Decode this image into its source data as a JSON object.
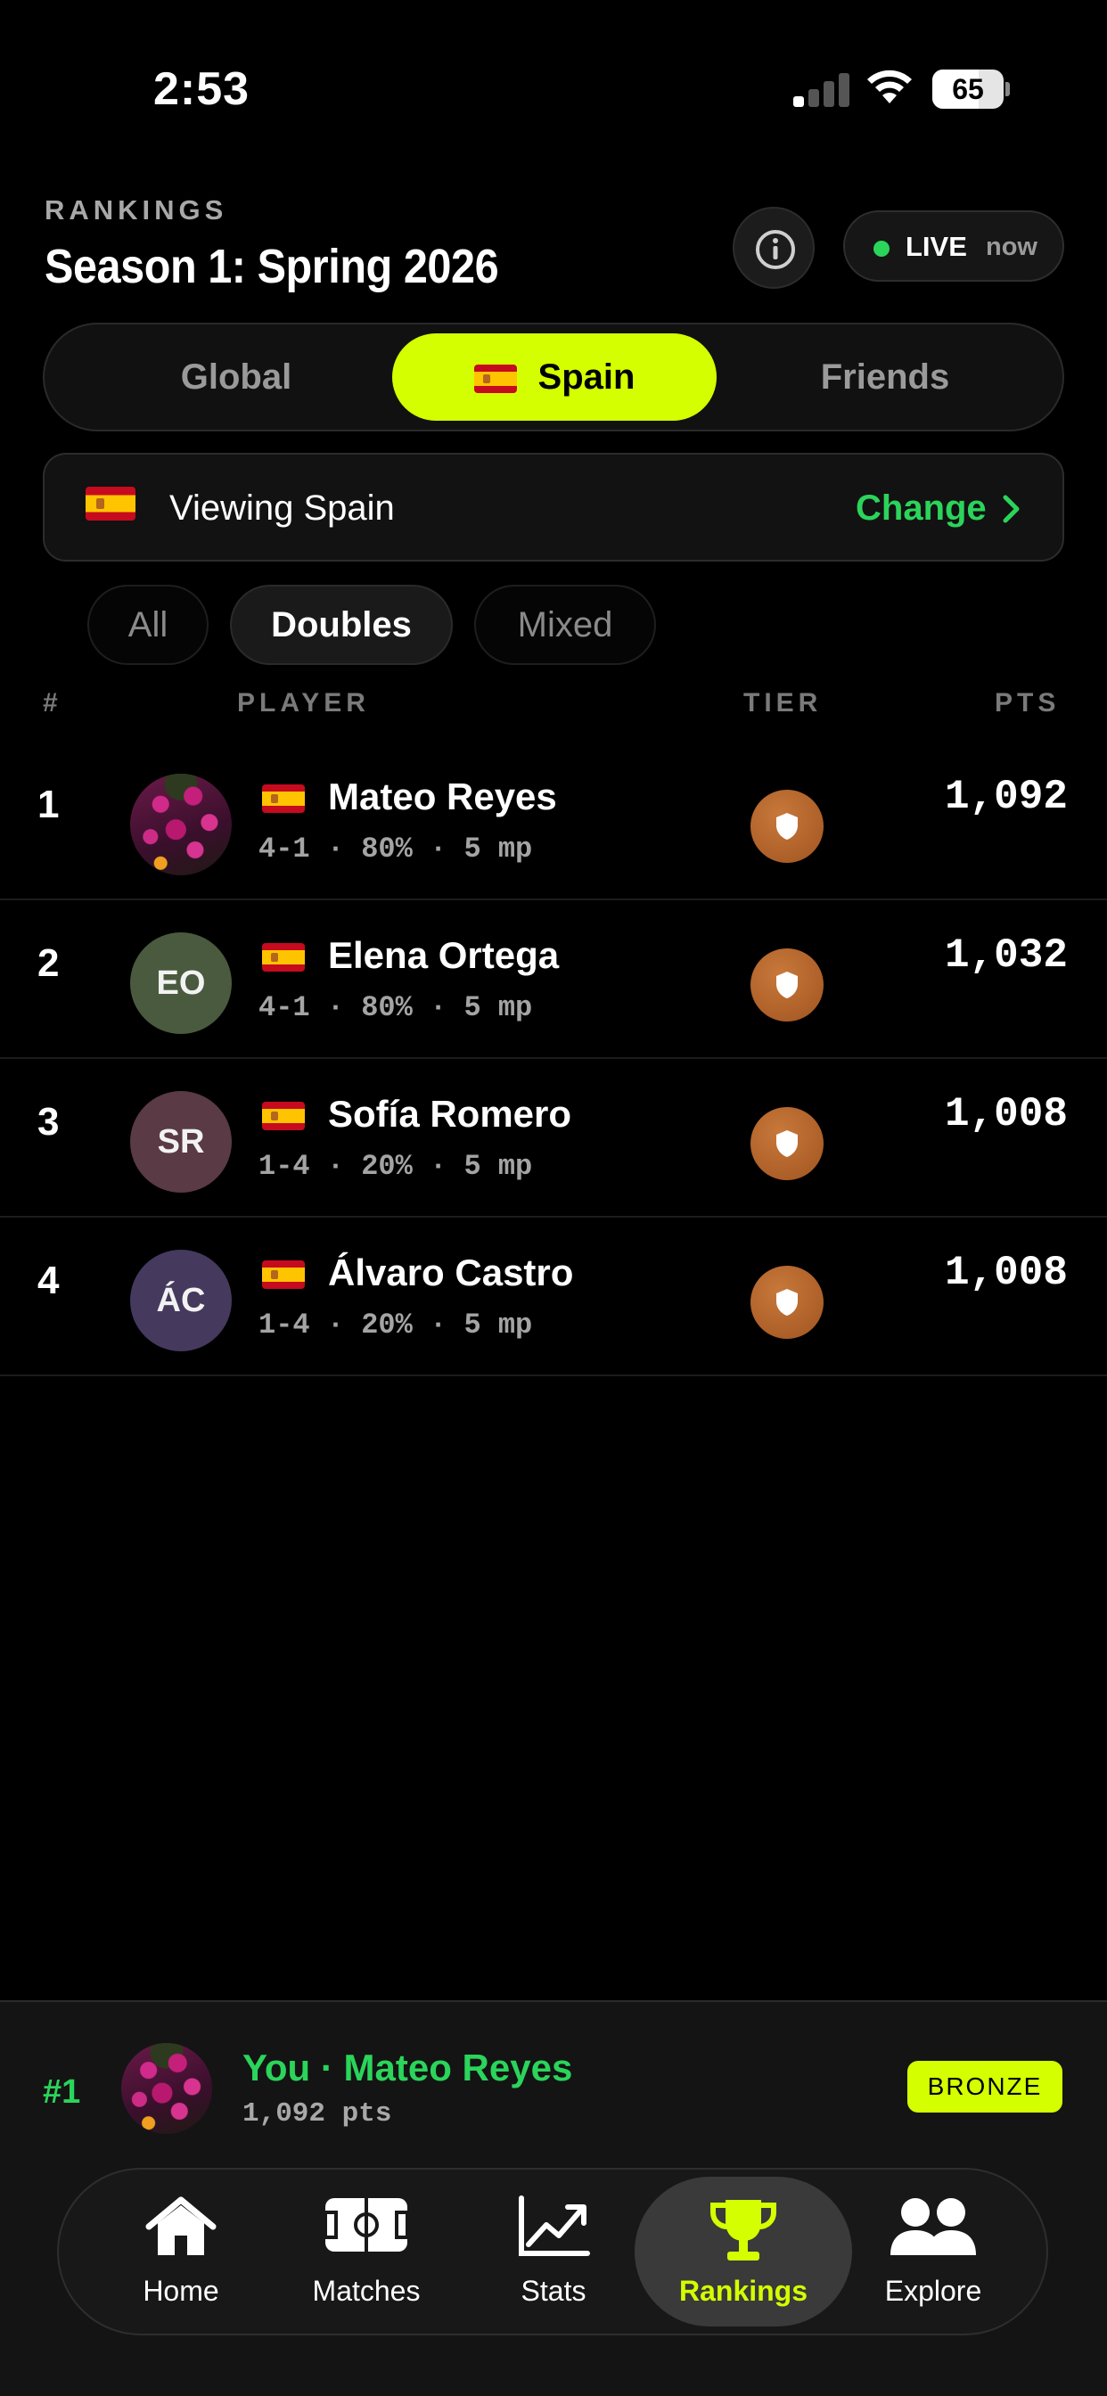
{
  "status_bar": {
    "time": "2:53",
    "battery": "65"
  },
  "header": {
    "eyebrow": "RANKINGS",
    "title": "Season 1: Spring 2026",
    "live_label": "LIVE",
    "live_when": "now"
  },
  "scope_tabs": [
    {
      "label": "Global",
      "selected": false
    },
    {
      "label": "Spain",
      "selected": true,
      "flag": "es-flag-icon"
    },
    {
      "label": "Friends",
      "selected": false
    }
  ],
  "viewing": {
    "text": "Viewing Spain",
    "action": "Change"
  },
  "filters": [
    {
      "label": "All",
      "selected": false
    },
    {
      "label": "Doubles",
      "selected": true
    },
    {
      "label": "Mixed",
      "selected": false
    }
  ],
  "columns": {
    "rank": "#",
    "player": "PLAYER",
    "tier": "TIER",
    "points": "PTS"
  },
  "rows": [
    {
      "rank": "1",
      "name": "Mateo Reyes",
      "initials": "",
      "avatar": "photo",
      "meta": "4-1 · 80% · 5 mp",
      "points": "1,092",
      "tier": "bronze"
    },
    {
      "rank": "2",
      "name": "Elena Ortega",
      "initials": "EO",
      "avatar_color": "#4a5a3e",
      "meta": "4-1 · 80% · 5 mp",
      "points": "1,032",
      "tier": "bronze"
    },
    {
      "rank": "3",
      "name": "Sofía Romero",
      "initials": "SR",
      "avatar_color": "#5a3a44",
      "meta": "1-4 · 20% · 5 mp",
      "points": "1,008",
      "tier": "bronze"
    },
    {
      "rank": "4",
      "name": "Álvaro Castro",
      "initials": "ÁC",
      "avatar_color": "#45395e",
      "meta": "1-4 · 20% · 5 mp",
      "points": "1,008",
      "tier": "bronze"
    }
  ],
  "you": {
    "rank": "#1",
    "name": "You · Mateo Reyes",
    "points": "1,092 pts",
    "tier": "BRONZE"
  },
  "tabbar": [
    {
      "label": "Home",
      "icon": "home-icon",
      "selected": false
    },
    {
      "label": "Matches",
      "icon": "court-icon",
      "selected": false
    },
    {
      "label": "Stats",
      "icon": "chart-icon",
      "selected": false
    },
    {
      "label": "Rankings",
      "icon": "trophy-icon",
      "selected": true
    },
    {
      "label": "Explore",
      "icon": "people-icon",
      "selected": false
    }
  ],
  "colors": {
    "accent": "#d4ff00",
    "green": "#2bd45a",
    "bronze": "#b8652a",
    "background": "#000000"
  }
}
